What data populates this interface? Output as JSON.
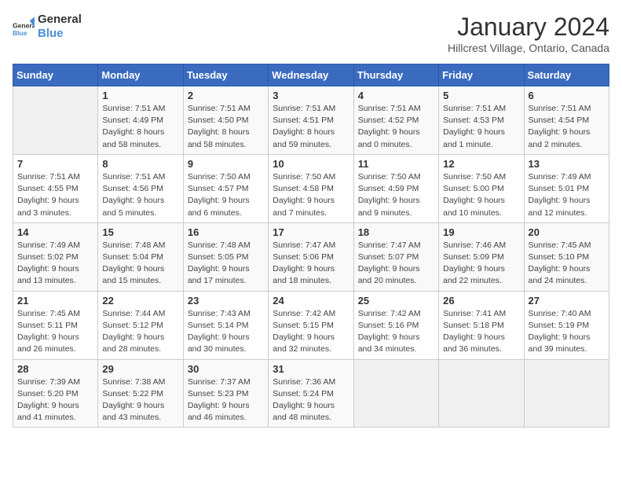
{
  "logo": {
    "line1": "General",
    "line2": "Blue"
  },
  "title": "January 2024",
  "subtitle": "Hillcrest Village, Ontario, Canada",
  "days_of_week": [
    "Sunday",
    "Monday",
    "Tuesday",
    "Wednesday",
    "Thursday",
    "Friday",
    "Saturday"
  ],
  "weeks": [
    [
      {
        "day": "",
        "info": ""
      },
      {
        "day": "1",
        "info": "Sunrise: 7:51 AM\nSunset: 4:49 PM\nDaylight: 8 hours\nand 58 minutes."
      },
      {
        "day": "2",
        "info": "Sunrise: 7:51 AM\nSunset: 4:50 PM\nDaylight: 8 hours\nand 58 minutes."
      },
      {
        "day": "3",
        "info": "Sunrise: 7:51 AM\nSunset: 4:51 PM\nDaylight: 8 hours\nand 59 minutes."
      },
      {
        "day": "4",
        "info": "Sunrise: 7:51 AM\nSunset: 4:52 PM\nDaylight: 9 hours\nand 0 minutes."
      },
      {
        "day": "5",
        "info": "Sunrise: 7:51 AM\nSunset: 4:53 PM\nDaylight: 9 hours\nand 1 minute."
      },
      {
        "day": "6",
        "info": "Sunrise: 7:51 AM\nSunset: 4:54 PM\nDaylight: 9 hours\nand 2 minutes."
      }
    ],
    [
      {
        "day": "7",
        "info": "Sunrise: 7:51 AM\nSunset: 4:55 PM\nDaylight: 9 hours\nand 3 minutes."
      },
      {
        "day": "8",
        "info": "Sunrise: 7:51 AM\nSunset: 4:56 PM\nDaylight: 9 hours\nand 5 minutes."
      },
      {
        "day": "9",
        "info": "Sunrise: 7:50 AM\nSunset: 4:57 PM\nDaylight: 9 hours\nand 6 minutes."
      },
      {
        "day": "10",
        "info": "Sunrise: 7:50 AM\nSunset: 4:58 PM\nDaylight: 9 hours\nand 7 minutes."
      },
      {
        "day": "11",
        "info": "Sunrise: 7:50 AM\nSunset: 4:59 PM\nDaylight: 9 hours\nand 9 minutes."
      },
      {
        "day": "12",
        "info": "Sunrise: 7:50 AM\nSunset: 5:00 PM\nDaylight: 9 hours\nand 10 minutes."
      },
      {
        "day": "13",
        "info": "Sunrise: 7:49 AM\nSunset: 5:01 PM\nDaylight: 9 hours\nand 12 minutes."
      }
    ],
    [
      {
        "day": "14",
        "info": "Sunrise: 7:49 AM\nSunset: 5:02 PM\nDaylight: 9 hours\nand 13 minutes."
      },
      {
        "day": "15",
        "info": "Sunrise: 7:48 AM\nSunset: 5:04 PM\nDaylight: 9 hours\nand 15 minutes."
      },
      {
        "day": "16",
        "info": "Sunrise: 7:48 AM\nSunset: 5:05 PM\nDaylight: 9 hours\nand 17 minutes."
      },
      {
        "day": "17",
        "info": "Sunrise: 7:47 AM\nSunset: 5:06 PM\nDaylight: 9 hours\nand 18 minutes."
      },
      {
        "day": "18",
        "info": "Sunrise: 7:47 AM\nSunset: 5:07 PM\nDaylight: 9 hours\nand 20 minutes."
      },
      {
        "day": "19",
        "info": "Sunrise: 7:46 AM\nSunset: 5:09 PM\nDaylight: 9 hours\nand 22 minutes."
      },
      {
        "day": "20",
        "info": "Sunrise: 7:45 AM\nSunset: 5:10 PM\nDaylight: 9 hours\nand 24 minutes."
      }
    ],
    [
      {
        "day": "21",
        "info": "Sunrise: 7:45 AM\nSunset: 5:11 PM\nDaylight: 9 hours\nand 26 minutes."
      },
      {
        "day": "22",
        "info": "Sunrise: 7:44 AM\nSunset: 5:12 PM\nDaylight: 9 hours\nand 28 minutes."
      },
      {
        "day": "23",
        "info": "Sunrise: 7:43 AM\nSunset: 5:14 PM\nDaylight: 9 hours\nand 30 minutes."
      },
      {
        "day": "24",
        "info": "Sunrise: 7:42 AM\nSunset: 5:15 PM\nDaylight: 9 hours\nand 32 minutes."
      },
      {
        "day": "25",
        "info": "Sunrise: 7:42 AM\nSunset: 5:16 PM\nDaylight: 9 hours\nand 34 minutes."
      },
      {
        "day": "26",
        "info": "Sunrise: 7:41 AM\nSunset: 5:18 PM\nDaylight: 9 hours\nand 36 minutes."
      },
      {
        "day": "27",
        "info": "Sunrise: 7:40 AM\nSunset: 5:19 PM\nDaylight: 9 hours\nand 39 minutes."
      }
    ],
    [
      {
        "day": "28",
        "info": "Sunrise: 7:39 AM\nSunset: 5:20 PM\nDaylight: 9 hours\nand 41 minutes."
      },
      {
        "day": "29",
        "info": "Sunrise: 7:38 AM\nSunset: 5:22 PM\nDaylight: 9 hours\nand 43 minutes."
      },
      {
        "day": "30",
        "info": "Sunrise: 7:37 AM\nSunset: 5:23 PM\nDaylight: 9 hours\nand 46 minutes."
      },
      {
        "day": "31",
        "info": "Sunrise: 7:36 AM\nSunset: 5:24 PM\nDaylight: 9 hours\nand 48 minutes."
      },
      {
        "day": "",
        "info": ""
      },
      {
        "day": "",
        "info": ""
      },
      {
        "day": "",
        "info": ""
      }
    ]
  ]
}
